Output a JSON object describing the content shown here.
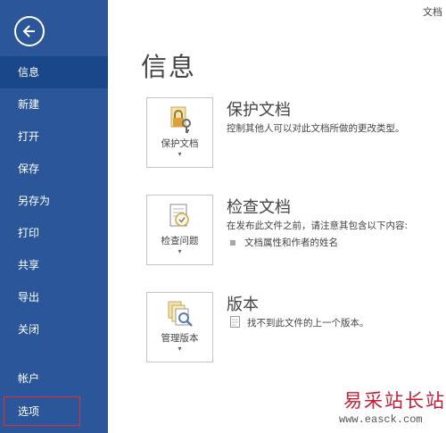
{
  "window": {
    "title_fragment": "文档"
  },
  "sidebar": {
    "back_label": "",
    "items": [
      {
        "label": "信息",
        "active": true
      },
      {
        "label": "新建"
      },
      {
        "label": "打开"
      },
      {
        "label": "保存"
      },
      {
        "label": "另存为"
      },
      {
        "label": "打印"
      },
      {
        "label": "共享"
      },
      {
        "label": "导出"
      },
      {
        "label": "关闭"
      },
      {
        "label": "帐户"
      },
      {
        "label": "选项",
        "highlighted": true
      }
    ]
  },
  "main": {
    "title": "信息",
    "sections": [
      {
        "tile_label": "保护文档",
        "tile_icon": "lock-key-icon",
        "title": "保护文档",
        "desc": "控制其他人可以对此文档所做的更改类型。"
      },
      {
        "tile_label": "检查问题",
        "tile_icon": "inspect-doc-icon",
        "title": "检查文档",
        "desc": "在发布此文件之前，请注意其包含以下内容:",
        "bullets": [
          "文档属性和作者的姓名"
        ]
      },
      {
        "tile_label": "管理版本",
        "tile_icon": "manage-versions-icon",
        "title": "版本",
        "desc": "找不到此文件的上一个版本。"
      }
    ]
  },
  "watermark": {
    "text_cn": "易采站长站",
    "url": "www.easck.com"
  },
  "colors": {
    "sidebar": "#2b579a",
    "active_item": "#19478a",
    "highlight_box": "#e03030",
    "watermark_red": "#c0203a"
  }
}
